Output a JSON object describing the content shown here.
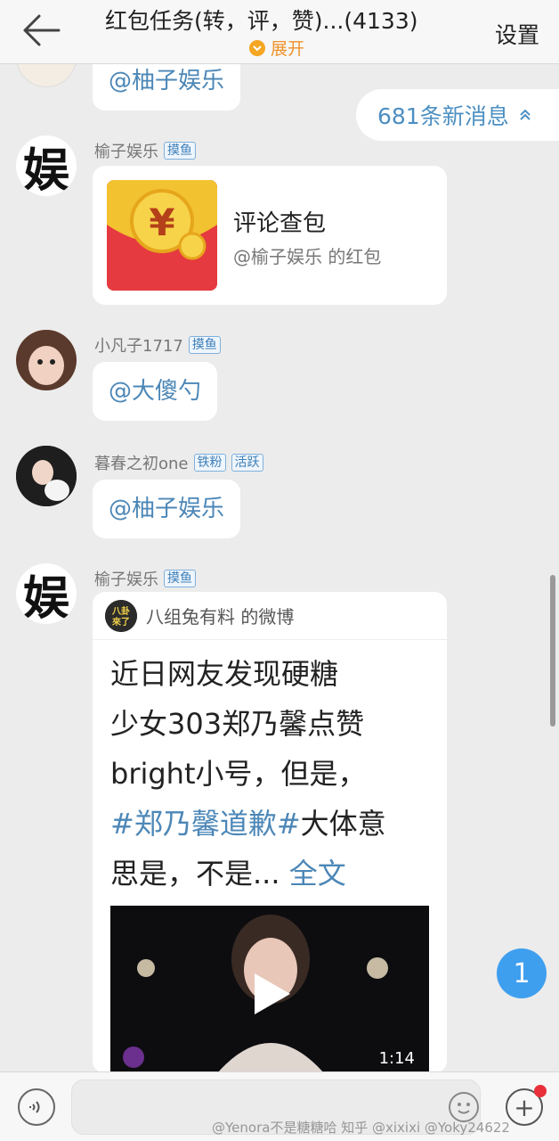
{
  "header": {
    "title": "红包任务(转，评，赞)...(4133)",
    "expand_label": "展开",
    "settings_label": "设置"
  },
  "new_messages": {
    "label": "681条新消息"
  },
  "messages": [
    {
      "text": "@柚子娱乐"
    },
    {
      "sender": "榆子娱乐",
      "tags": [
        "摸鱼"
      ],
      "avatar_text": "娱",
      "red_packet": {
        "title": "评论查包",
        "subtitle": "@榆子娱乐 的红包"
      }
    },
    {
      "sender": "小凡子1717",
      "tags": [
        "摸鱼"
      ],
      "text": "@大傻勺"
    },
    {
      "sender": "暮春之初one",
      "tags": [
        "铁粉",
        "活跃"
      ],
      "text": "@柚子娱乐"
    },
    {
      "sender": "榆子娱乐",
      "tags": [
        "摸鱼"
      ],
      "avatar_text": "娱",
      "weibo": {
        "source": "八组兔有料 的微博",
        "avatar_text": "八卦來了",
        "line1": "近日网友发现硬糖",
        "line2": "少女303郑乃馨点赞",
        "line3": "bright小号，但是，",
        "hashtag": "#郑乃馨道歉#",
        "line4_rest": "大体意",
        "line5": "思是，不是...",
        "full_text": "全文",
        "video_duration": "1:14"
      }
    }
  ],
  "float_badge": "1",
  "bottom_bar": {
    "watermark": "@Yenora不是糖糖哈   知乎 @xixixi  @Yoky24622"
  }
}
